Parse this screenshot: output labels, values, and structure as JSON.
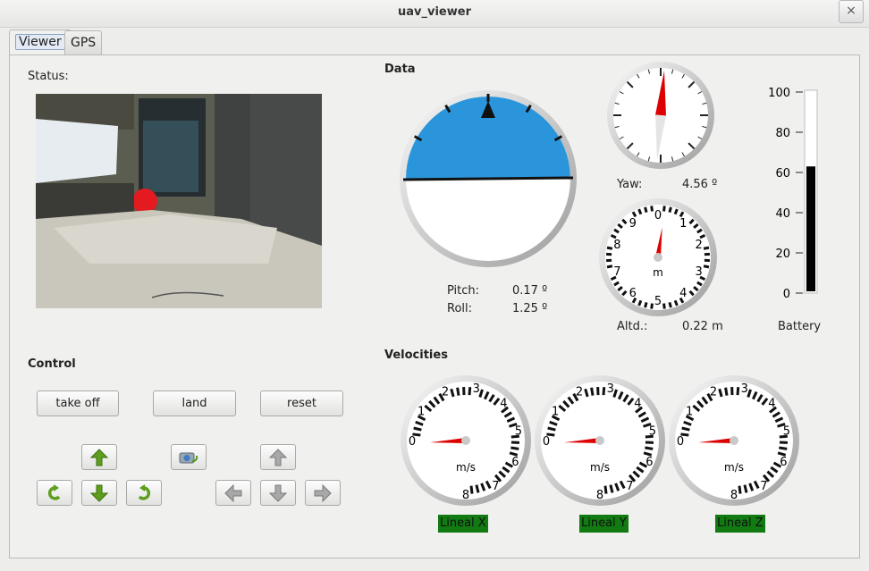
{
  "window": {
    "title": "uav_viewer",
    "close_icon": "×"
  },
  "tabs": [
    {
      "label": "Viewer"
    },
    {
      "label": "GPS"
    }
  ],
  "status": {
    "label": "Status:"
  },
  "control": {
    "label": "Control",
    "buttons": {
      "take_off": "take off",
      "land": "land",
      "reset": "reset"
    }
  },
  "data_section": {
    "label": "Data"
  },
  "attitude": {
    "pitch_label": "Pitch:",
    "pitch_value": "0.17 º",
    "roll_label": "Roll:",
    "roll_value": "1.25 º"
  },
  "yaw": {
    "label": "Yaw:",
    "value": "4.56 º"
  },
  "altitude": {
    "label": "Altd.:",
    "value": "0.22 m",
    "unit": "m",
    "ticks": [
      "0",
      "1",
      "2",
      "3",
      "4",
      "5",
      "6",
      "7",
      "8",
      "9"
    ]
  },
  "battery": {
    "label": "Battery",
    "level_percent": 63,
    "ticks": [
      "100",
      "80",
      "60",
      "40",
      "20",
      "0"
    ]
  },
  "velocities": {
    "label": "Velocities",
    "unit": "m/s",
    "ticks": [
      "0",
      "1",
      "2",
      "3",
      "4",
      "5",
      "6",
      "7",
      "8"
    ],
    "gauges": [
      {
        "name": "Lineal X"
      },
      {
        "name": "Lineal Y"
      },
      {
        "name": "Lineal Z"
      }
    ]
  },
  "colors": {
    "sky": "#2b95dc",
    "needle": "#dd0000",
    "badge": "#127a12",
    "battery_fill": "#000000"
  }
}
